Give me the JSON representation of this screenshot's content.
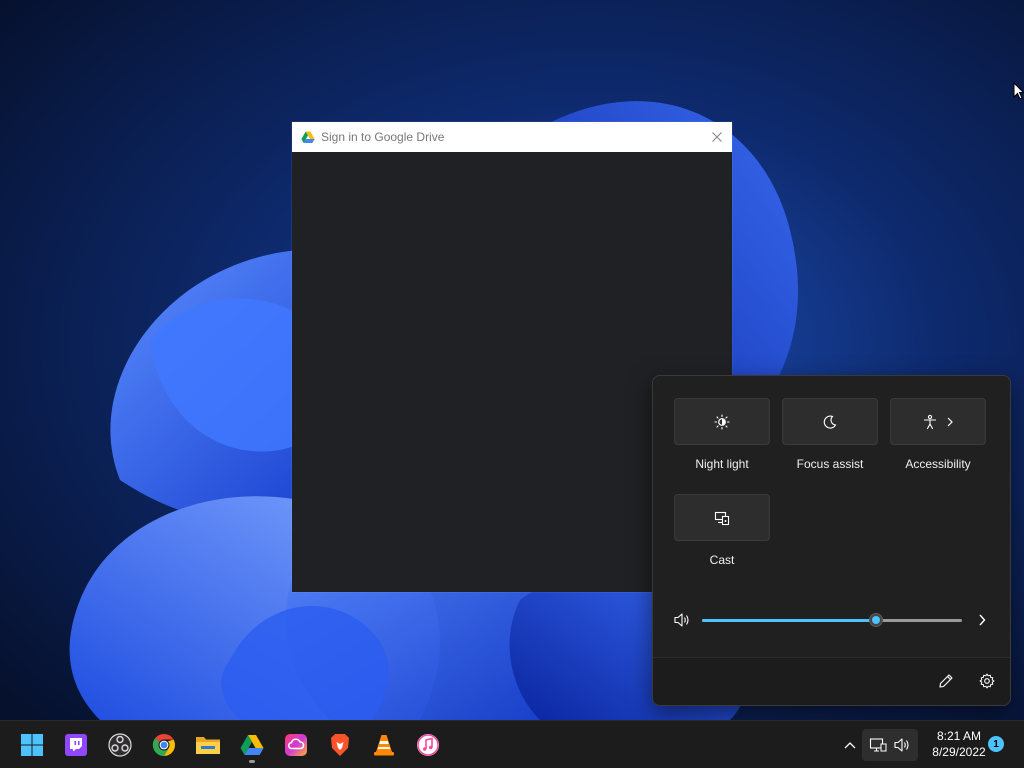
{
  "dialog": {
    "title": "Sign in to Google Drive",
    "icon": "google-drive-icon",
    "close_icon": "close-icon"
  },
  "quick_settings": {
    "tiles": [
      {
        "label": "Night light",
        "icon": "night-light-icon"
      },
      {
        "label": "Focus assist",
        "icon": "moon-icon"
      },
      {
        "label": "Accessibility",
        "icon": "accessibility-icon"
      },
      {
        "label": "Cast",
        "icon": "cast-icon"
      }
    ],
    "volume": {
      "icon": "speaker-icon",
      "level": 0.67,
      "next_icon": "chevron-right-icon"
    },
    "footer": {
      "edit_icon": "pencil-icon",
      "settings_icon": "gear-icon"
    },
    "accent": "#4cc2ff"
  },
  "taskbar": {
    "apps": [
      {
        "name": "start",
        "icon": "windows-start-icon"
      },
      {
        "name": "twitch",
        "icon": "twitch-icon"
      },
      {
        "name": "obs",
        "icon": "obs-icon"
      },
      {
        "name": "chrome",
        "icon": "chrome-icon"
      },
      {
        "name": "file-explorer",
        "icon": "folder-icon"
      },
      {
        "name": "google-drive",
        "icon": "google-drive-icon",
        "running": true
      },
      {
        "name": "creative-cloud",
        "icon": "creative-cloud-icon"
      },
      {
        "name": "brave",
        "icon": "brave-icon"
      },
      {
        "name": "vlc",
        "icon": "vlc-icon"
      },
      {
        "name": "itunes",
        "icon": "itunes-icon"
      }
    ],
    "tray": {
      "overflow_icon": "chevron-up-icon",
      "network_icon": "network-icon",
      "volume_icon": "speaker-icon"
    },
    "clock": {
      "time": "8:21 AM",
      "date": "8/29/2022"
    },
    "notifications": "1"
  }
}
